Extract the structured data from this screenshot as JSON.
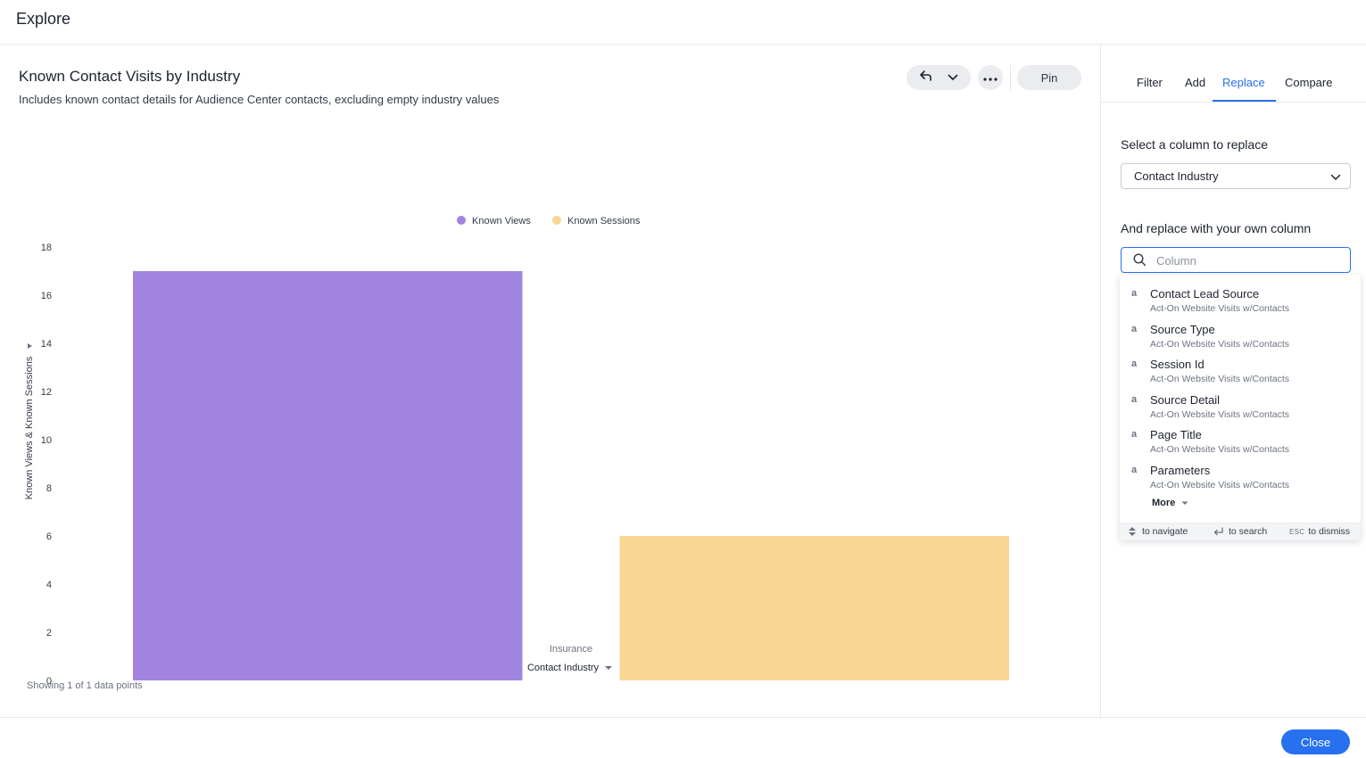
{
  "app": {
    "title": "Explore"
  },
  "chart_header": {
    "title": "Known Contact Visits by Industry",
    "description": "Includes known contact details for Audience Center contacts, excluding empty industry values",
    "pin_label": "Pin"
  },
  "chart_data": {
    "type": "bar",
    "categories": [
      "Insurance"
    ],
    "series": [
      {
        "name": "Known Views",
        "values": [
          17
        ],
        "color": "#a084e0"
      },
      {
        "name": "Known Sessions",
        "values": [
          6
        ],
        "color": "#f8d694"
      }
    ],
    "ylabel": "Known Views & Known Sessions",
    "xlabel": "Contact Industry",
    "ylim": [
      0,
      18
    ],
    "yticks": [
      0,
      2,
      4,
      6,
      8,
      10,
      12,
      14,
      16,
      18
    ],
    "grid": false,
    "legend": "top-center",
    "footer": "Showing 1 of 1 data points"
  },
  "panel": {
    "tabs": [
      "Filter",
      "Add",
      "Replace",
      "Compare"
    ],
    "active_tab": "Replace",
    "select_label": "Select a column to replace",
    "selected_column": "Contact Industry",
    "replace_label": "And replace with your own column",
    "search_placeholder": "Column",
    "search_value": ""
  },
  "dropdown": {
    "items": [
      {
        "type": "a",
        "name": "Contact Lead Source",
        "source": "Act-On Website Visits w/Contacts"
      },
      {
        "type": "a",
        "name": "Source Type",
        "source": "Act-On Website Visits w/Contacts"
      },
      {
        "type": "a",
        "name": "Session Id",
        "source": "Act-On Website Visits w/Contacts"
      },
      {
        "type": "a",
        "name": "Source Detail",
        "source": "Act-On Website Visits w/Contacts"
      },
      {
        "type": "a",
        "name": "Page Title",
        "source": "Act-On Website Visits w/Contacts"
      },
      {
        "type": "a",
        "name": "Parameters",
        "source": "Act-On Website Visits w/Contacts"
      }
    ],
    "more_label": "More",
    "hints": {
      "navigate": "to navigate",
      "search": "to search",
      "dismiss_key": "ESC",
      "dismiss": "to dismiss"
    }
  },
  "footer": {
    "close_label": "Close"
  },
  "colors": {
    "accent": "#2770ef",
    "views": "#a084e0",
    "sessions": "#f8d694"
  }
}
